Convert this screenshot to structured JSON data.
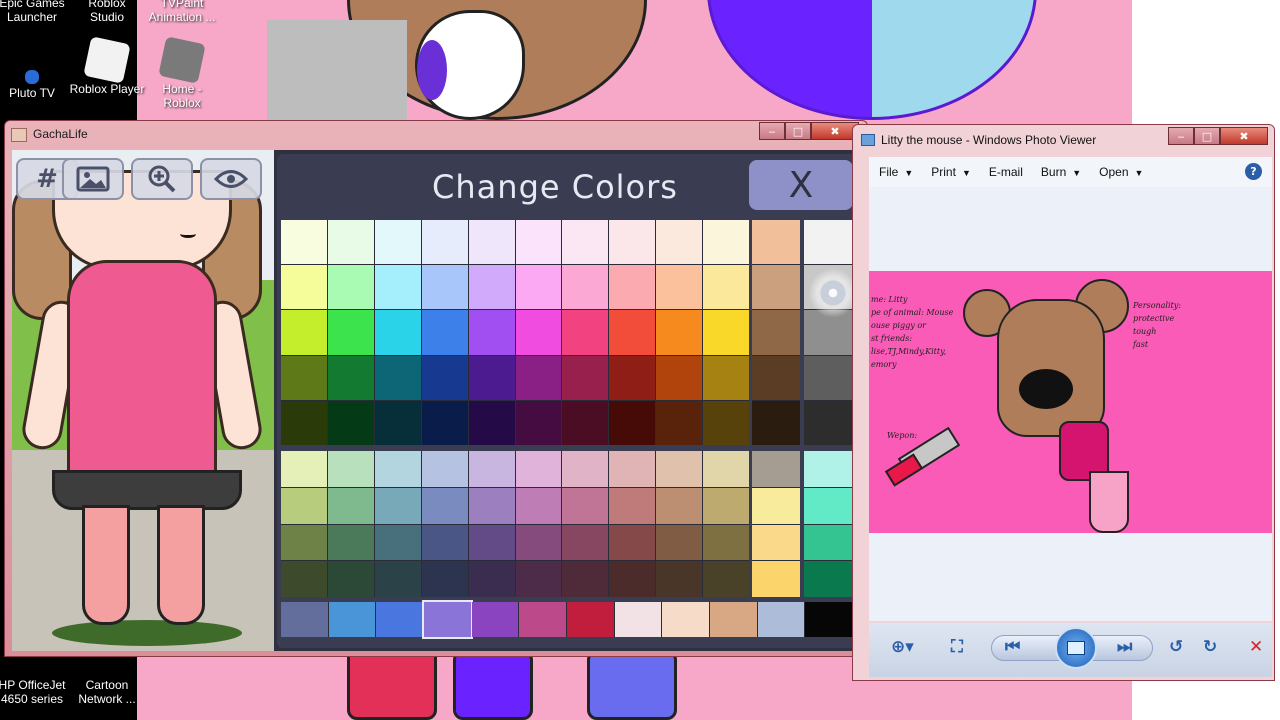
{
  "desktop": {
    "icons": [
      {
        "id": "epic",
        "label": "Epic Games\nLauncher"
      },
      {
        "id": "roblox-studio",
        "label": "Roblox\nStudio"
      },
      {
        "id": "tvpaint",
        "label": "TVPaint\nAnimation ..."
      },
      {
        "id": "pluto",
        "label": "Pluto TV"
      },
      {
        "id": "roblox-player",
        "label": "Roblox Player"
      },
      {
        "id": "home-roblox",
        "label": "Home -\nRoblox"
      },
      {
        "id": "hp",
        "label": "HP OfficeJet\n4650 series"
      },
      {
        "id": "cartoon",
        "label": "Cartoon\nNetwork ..."
      }
    ]
  },
  "gacha": {
    "window_title": "GachaLife",
    "caption": {
      "minimize": "‒",
      "maximize": "□",
      "close": "✖"
    },
    "tools": [
      "#",
      "picture",
      "zoom",
      "eye"
    ],
    "panel_title": "Change Colors",
    "close_label": "X",
    "palette_main": [
      [
        "#f8fde0",
        "#e8fbe6",
        "#e2f8fb",
        "#e6ecfb",
        "#efe6fb",
        "#fbe3fb",
        "#fbe6f3",
        "#fbe6ea",
        "#fbe9de",
        "#fbf5dc"
      ],
      [
        "#f4fd9a",
        "#a9fbb4",
        "#a5eefb",
        "#a9c6fb",
        "#d1aafb",
        "#fba9f3",
        "#fba9d4",
        "#fbaab0",
        "#fbc09c",
        "#fbe89a"
      ],
      [
        "#c4ed2c",
        "#3ce34c",
        "#2ad3e8",
        "#3d80ea",
        "#a14ff1",
        "#f04de0",
        "#f2427f",
        "#f14d3a",
        "#f78a1e",
        "#f9d82a"
      ],
      [
        "#5e7a18",
        "#127a31",
        "#0d6676",
        "#17398f",
        "#4b1b8f",
        "#8a1f86",
        "#97214c",
        "#8f1f16",
        "#b1440c",
        "#a58212"
      ],
      [
        "#2a3a08",
        "#053a16",
        "#062f3a",
        "#0a1c4a",
        "#240b48",
        "#450c42",
        "#4b0d24",
        "#460b07",
        "#58230a",
        "#56420a"
      ]
    ],
    "palette_skin": [
      "#f1c09a",
      "#caa07e",
      "#8f6947",
      "#5a3d24",
      "#2b1c10"
    ],
    "palette_gray": [
      "#f2f2f2",
      "#c8c8c8",
      "#8f8f8f",
      "#5e5e5e",
      "#2d2d2d"
    ],
    "palette_muted": [
      [
        "#e4f0b8",
        "#b8e0bc",
        "#b3d5df",
        "#b5c2e2",
        "#c9b6e0",
        "#e0b4da",
        "#e1b3c6",
        "#e0b4b4",
        "#dfc1ac",
        "#e0d6aa"
      ],
      [
        "#b8cc7e",
        "#7fba8e",
        "#78a9b8",
        "#7a8bbf",
        "#9b7fbf",
        "#bf7db6",
        "#c07596",
        "#bf7a7a",
        "#bd8f72",
        "#bdaa6e"
      ],
      [
        "#6e8248",
        "#4a7a5a",
        "#48707c",
        "#4a5786",
        "#624b86",
        "#844b7c",
        "#874760",
        "#844948",
        "#805c44",
        "#7e7040"
      ],
      [
        "#3e4a2c",
        "#2c4836",
        "#2b4249",
        "#2d3450",
        "#3a2d50",
        "#4d2c4a",
        "#4f2b3a",
        "#4c2c2b",
        "#4a3628",
        "#494128"
      ]
    ],
    "palette_muted_a": [
      "#a59c92",
      "#f8ec9c",
      "#fbd98a",
      "#fcd46c"
    ],
    "palette_muted_b": [
      "#b0f2e8",
      "#62eac6",
      "#33c492",
      "#0a7a4e"
    ],
    "palette_bottom": [
      "#646e9c",
      "#4a94d8",
      "#4a76e0",
      "#8a74d8",
      "#8a44c0",
      "#bc4a8a",
      "#c01e3c",
      "#f2e2e6",
      "#f6dcc8",
      "#d8a884",
      "#adbcd8",
      "#060606"
    ]
  },
  "photo_viewer": {
    "window_title": "Litty the mouse - Windows Photo Viewer",
    "menu": [
      {
        "label": "File",
        "has_arrow": true
      },
      {
        "label": "Print",
        "has_arrow": true
      },
      {
        "label": "E-mail",
        "has_arrow": false
      },
      {
        "label": "Burn",
        "has_arrow": true
      },
      {
        "label": "Open",
        "has_arrow": true
      }
    ],
    "help": "?",
    "drawing_text": {
      "left": "me: Litty\npe of animal: Mouse\nouse piggy or\nst friends:\nlise,TJ,Mindy,Kitty,\nemory",
      "right": "Personality:\nprotective\ntough\nfast",
      "weapon": "Wepon:"
    },
    "colors": {
      "accent": "#2b5ea8",
      "image_bg": "#f95bb6"
    }
  }
}
